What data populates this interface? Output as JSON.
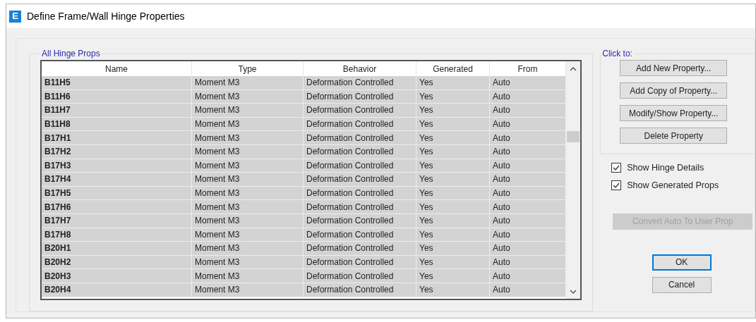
{
  "window": {
    "title": "Define Frame/Wall Hinge Properties",
    "icon_letter": "E"
  },
  "hinge_props": {
    "label": "All Hinge Props",
    "columns": [
      "Name",
      "Type",
      "Behavior",
      "Generated",
      "From"
    ],
    "rows": [
      [
        "B11H5",
        "Moment M3",
        "Deformation Controlled",
        "Yes",
        "Auto"
      ],
      [
        "B11H6",
        "Moment M3",
        "Deformation Controlled",
        "Yes",
        "Auto"
      ],
      [
        "B11H7",
        "Moment M3",
        "Deformation Controlled",
        "Yes",
        "Auto"
      ],
      [
        "B11H8",
        "Moment M3",
        "Deformation Controlled",
        "Yes",
        "Auto"
      ],
      [
        "B17H1",
        "Moment M3",
        "Deformation Controlled",
        "Yes",
        "Auto"
      ],
      [
        "B17H2",
        "Moment M3",
        "Deformation Controlled",
        "Yes",
        "Auto"
      ],
      [
        "B17H3",
        "Moment M3",
        "Deformation Controlled",
        "Yes",
        "Auto"
      ],
      [
        "B17H4",
        "Moment M3",
        "Deformation Controlled",
        "Yes",
        "Auto"
      ],
      [
        "B17H5",
        "Moment M3",
        "Deformation Controlled",
        "Yes",
        "Auto"
      ],
      [
        "B17H6",
        "Moment M3",
        "Deformation Controlled",
        "Yes",
        "Auto"
      ],
      [
        "B17H7",
        "Moment M3",
        "Deformation Controlled",
        "Yes",
        "Auto"
      ],
      [
        "B17H8",
        "Moment M3",
        "Deformation Controlled",
        "Yes",
        "Auto"
      ],
      [
        "B20H1",
        "Moment M3",
        "Deformation Controlled",
        "Yes",
        "Auto"
      ],
      [
        "B20H2",
        "Moment M3",
        "Deformation Controlled",
        "Yes",
        "Auto"
      ],
      [
        "B20H3",
        "Moment M3",
        "Deformation Controlled",
        "Yes",
        "Auto"
      ],
      [
        "B20H4",
        "Moment M3",
        "Deformation Controlled",
        "Yes",
        "Auto"
      ]
    ]
  },
  "click_to": {
    "label": "Click to:",
    "buttons": [
      "Add New Property...",
      "Add Copy of Property...",
      "Modify/Show Property...",
      "Delete Property"
    ]
  },
  "options": [
    {
      "label": "Show Hinge Details",
      "checked": true
    },
    {
      "label": "Show Generated Props",
      "checked": true
    }
  ],
  "convert_button": {
    "label": "Convert Auto To User Prop",
    "disabled": true
  },
  "ok_button": "OK",
  "cancel_button": "Cancel"
}
